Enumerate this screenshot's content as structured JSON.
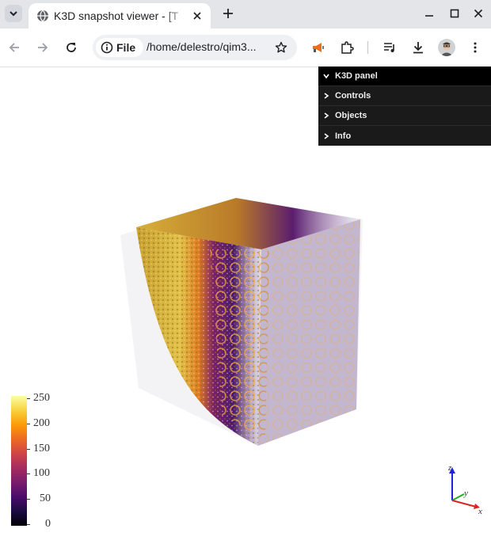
{
  "browser": {
    "tab_title": "K3D snapshot viewer - [T",
    "url_scheme_label": "File",
    "url": "/home/delestro/qim3..."
  },
  "k3d_panel": {
    "title": "K3D panel",
    "sections": [
      "Controls",
      "Objects",
      "Info"
    ]
  },
  "colorbar": {
    "ticks": [
      "250",
      "200",
      "150",
      "100",
      "50",
      "0"
    ],
    "colormap": "inferno",
    "range": [
      0,
      250
    ]
  },
  "axes": {
    "x": "x",
    "y": "y",
    "z": "z",
    "x_color": "#e02020",
    "y_color": "#20b020",
    "z_color": "#2020e0"
  },
  "icons": {
    "tab_menu": "chevron-down-icon",
    "favicon": "globe-icon",
    "tab_close": "close-icon",
    "new_tab": "plus-icon",
    "minimize": "minimize-icon",
    "maximize": "maximize-icon",
    "close_window": "close-icon",
    "back": "arrow-left-icon",
    "forward": "arrow-right-icon",
    "reload": "reload-icon",
    "site_info": "info-icon",
    "bookmark": "star-icon",
    "extension_1": "megaphone-icon",
    "extensions": "puzzle-icon",
    "media": "media-queue-icon",
    "downloads": "download-icon",
    "menu": "kebab-menu-icon"
  }
}
